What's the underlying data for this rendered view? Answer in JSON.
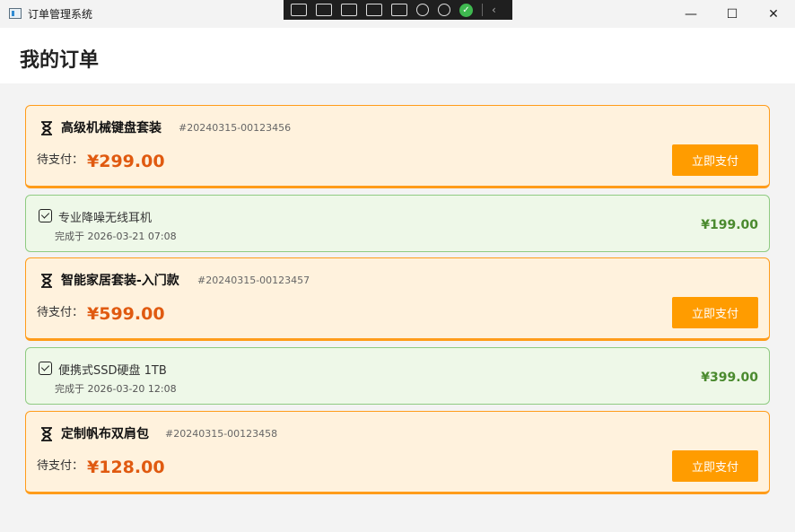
{
  "window": {
    "title": "订单管理系统",
    "minimize": "—",
    "maximize": "☐",
    "close": "✕"
  },
  "header": {
    "title": "我的订单"
  },
  "orders": [
    {
      "status": "pending",
      "name": "高级机械键盘套装",
      "order_no": "#20240315-00123456",
      "pay_label": "待支付：",
      "amount": "¥299.00",
      "action": "立即支付"
    },
    {
      "status": "completed",
      "name": "专业降噪无线耳机",
      "completed_at": "完成于 2026-03-21 07:08",
      "amount": "¥199.00"
    },
    {
      "status": "pending",
      "name": "智能家居套装-入门款",
      "order_no": "#20240315-00123457",
      "pay_label": "待支付：",
      "amount": "¥599.00",
      "action": "立即支付"
    },
    {
      "status": "completed",
      "name": "便携式SSD硬盘 1TB",
      "completed_at": "完成于 2026-03-20 12:08",
      "amount": "¥399.00"
    },
    {
      "status": "pending",
      "name": "定制帆布双肩包",
      "order_no": "#20240315-00123458",
      "pay_label": "待支付：",
      "amount": "¥128.00",
      "action": "立即支付"
    }
  ],
  "colors": {
    "pending_bg": "#fff2dd",
    "pending_border": "#ff9c1a",
    "completed_bg": "#eef8e8",
    "completed_border": "#8fcb82",
    "pay_button": "#ff9c00",
    "amount_pending": "#e05a10",
    "amount_completed": "#4a8a2e"
  }
}
